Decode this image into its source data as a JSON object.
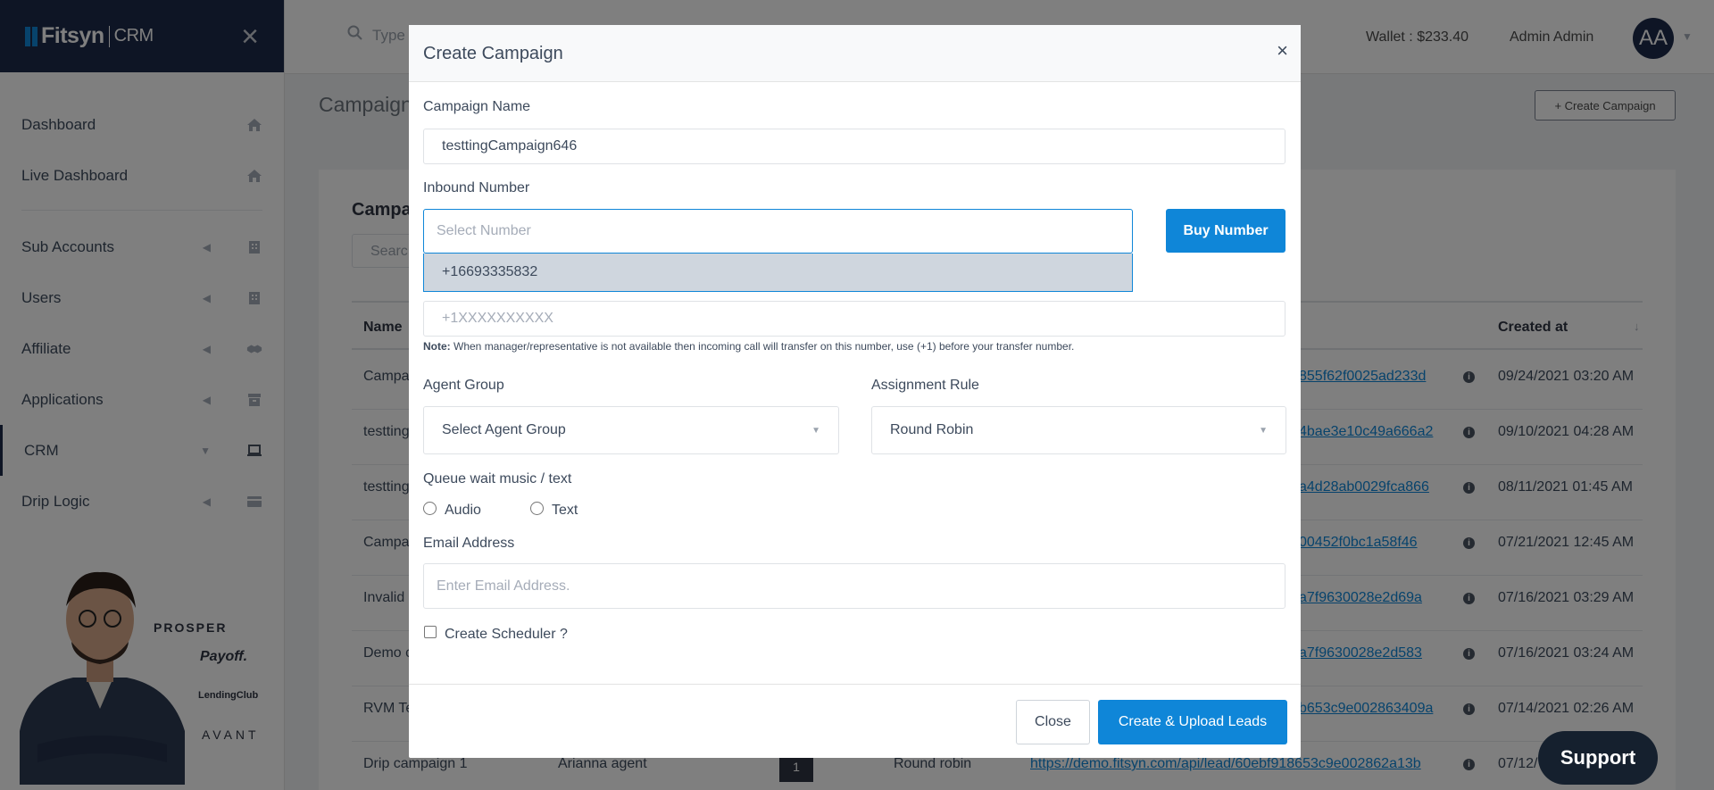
{
  "app": {
    "brand": "Fitsyn",
    "brand_suffix": "CRM"
  },
  "sidebar": {
    "items": [
      {
        "label": "Dashboard",
        "icon": "home-icon"
      },
      {
        "label": "Live Dashboard",
        "icon": "home-icon"
      },
      {
        "label": "Sub Accounts",
        "icon": "building-icon"
      },
      {
        "label": "Users",
        "icon": "building-icon"
      },
      {
        "label": "Affiliate",
        "icon": "handshake-icon"
      },
      {
        "label": "Applications",
        "icon": "archive-icon"
      },
      {
        "label": "CRM",
        "icon": "laptop-icon"
      },
      {
        "label": "Drip Logic",
        "icon": "card-icon"
      }
    ],
    "promo_brands": [
      "PROSPER",
      "Payoff.",
      "LendingClub",
      "AVANT"
    ]
  },
  "topbar": {
    "search_placeholder": "Type",
    "wallet": "Wallet : $233.40",
    "user_name": "Admin Admin",
    "avatar_initials": "AA"
  },
  "page": {
    "title": "Campaign",
    "create_button": "+ Create Campaign",
    "card_title": "Campa",
    "search_placeholder": "Searc",
    "columns": [
      "Name",
      "Created at"
    ],
    "rows": [
      {
        "name": "Campa",
        "link": "855f62f0025ad233d",
        "created": "09/24/2021 03:20 AM"
      },
      {
        "name": "testting",
        "link": "4bae3e10c49a666a2",
        "created": "09/10/2021 04:28 AM"
      },
      {
        "name": "testting",
        "link": "a4d28ab0029fca866",
        "created": "08/11/2021 01:45 AM"
      },
      {
        "name": "Campa",
        "link": "00452f0bc1a58f46",
        "created": "07/21/2021 12:45 AM"
      },
      {
        "name": "Invalid",
        "link": "a7f9630028e2d69a",
        "created": "07/16/2021 03:29 AM"
      },
      {
        "name": "Demo c",
        "link": "a7f9630028e2d583",
        "created": "07/16/2021 03:24 AM"
      },
      {
        "name": "RVM Te",
        "link": "b653c9e002863409a",
        "created": "07/14/2021 02:26 AM"
      },
      {
        "name": "Drip campaign 1",
        "agent": "Arianna agent",
        "count": "1",
        "rule": "Round robin",
        "link": "https://demo.fitsyn.com/api/lead/60ebf918653c9e002862a13b",
        "created": "07/12/"
      }
    ]
  },
  "modal": {
    "title": "Create Campaign",
    "close_x": "×",
    "campaign_name_label": "Campaign Name",
    "campaign_name_value": "testtingCampaign646",
    "inbound_label": "Inbound Number",
    "inbound_placeholder": "Select Number",
    "inbound_option": "+16693335832",
    "buy_button": "Buy Number",
    "transfer_placeholder": "+1XXXXXXXXXX",
    "note_bold": "Note:",
    "note_text": " When manager/representative is not available then incoming call will transfer on this number, use (+1) before your transfer number.",
    "agent_group_label": "Agent Group",
    "agent_group_value": "Select Agent Group",
    "assignment_label": "Assignment Rule",
    "assignment_value": "Round Robin",
    "queue_label": "Queue wait music / text",
    "radio_audio": "Audio",
    "radio_text": "Text",
    "email_label": "Email Address",
    "email_placeholder": "Enter Email Address.",
    "scheduler_label": "Create Scheduler ?",
    "close_button": "Close",
    "primary_button": "Create & Upload Leads"
  },
  "support": {
    "label": "Support"
  },
  "colors": {
    "navy": "#1c2a4a",
    "primary": "#0f86d8",
    "overlay": "rgba(0,0,0,0.5)"
  }
}
